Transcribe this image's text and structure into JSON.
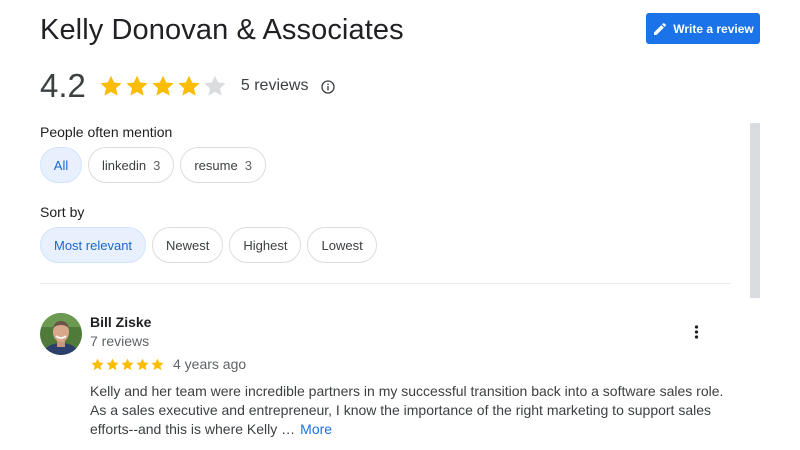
{
  "header": {
    "title": "Kelly Donovan & Associates",
    "write_review_label": "Write a review"
  },
  "rating": {
    "value": "4.2",
    "stars": 4,
    "max_stars": 5,
    "review_count": "5 reviews",
    "info_icon": "info-icon"
  },
  "mentions": {
    "label": "People often mention",
    "chips": [
      {
        "label": "All",
        "count": "",
        "selected": true
      },
      {
        "label": "linkedin",
        "count": "3",
        "selected": false
      },
      {
        "label": "resume",
        "count": "3",
        "selected": false
      }
    ]
  },
  "sort": {
    "label": "Sort by",
    "options": [
      {
        "label": "Most relevant",
        "selected": true
      },
      {
        "label": "Newest",
        "selected": false
      },
      {
        "label": "Highest",
        "selected": false
      },
      {
        "label": "Lowest",
        "selected": false
      }
    ]
  },
  "review": {
    "name": "Bill Ziske",
    "meta": "7 reviews",
    "stars": 5,
    "date": "4 years ago",
    "line1": "Kelly and her team were incredible partners in my successful transition back into a software sales role.",
    "line2": "As a sales executive and entrepreneur, I know the importance of the right marketing to support sales",
    "line3": "efforts--and this is where Kelly …",
    "more_label": "More"
  },
  "colors": {
    "accent": "#1a73e8",
    "star": "#fbbc04",
    "star_empty": "#dadce0",
    "chip_selected_bg": "#e8f0fe"
  }
}
